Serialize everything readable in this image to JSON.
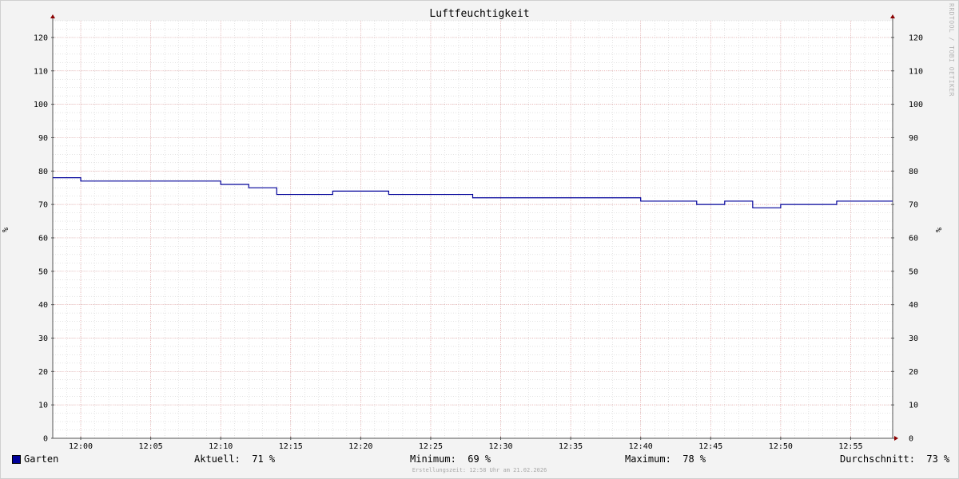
{
  "chart_data": {
    "type": "line",
    "title": "Luftfeuchtigkeit",
    "ylabel": "%",
    "ylabel_right": "%",
    "ylim": [
      0,
      125
    ],
    "yticks": [
      0,
      10,
      20,
      30,
      40,
      50,
      60,
      70,
      80,
      90,
      100,
      110,
      120
    ],
    "xlim": [
      "11:58",
      "12:58"
    ],
    "xticks": [
      "12:00",
      "12:05",
      "12:10",
      "12:15",
      "12:20",
      "12:25",
      "12:30",
      "12:35",
      "12:40",
      "12:45",
      "12:50",
      "12:55"
    ],
    "grid": true,
    "series": [
      {
        "name": "Garten",
        "color": "#000099",
        "step": true,
        "points": [
          [
            "11:58",
            78
          ],
          [
            "12:00",
            77
          ],
          [
            "12:10",
            76
          ],
          [
            "12:12",
            75
          ],
          [
            "12:14",
            73
          ],
          [
            "12:18",
            74
          ],
          [
            "12:22",
            73
          ],
          [
            "12:28",
            72
          ],
          [
            "12:40",
            71
          ],
          [
            "12:44",
            70
          ],
          [
            "12:46",
            71
          ],
          [
            "12:48",
            69
          ],
          [
            "12:50",
            70
          ],
          [
            "12:54",
            71
          ],
          [
            "12:58",
            71
          ]
        ]
      }
    ]
  },
  "legend": {
    "series_name": "Garten",
    "current": "Aktuell:  71 %",
    "minimum": "Minimum:  69 %",
    "maximum": "Maximum:  78 %",
    "average": "Durchschnitt:  73 %"
  },
  "footer": "Erstellungszeit: 12:58 Uhr am 21.02.2026",
  "watermark": "RRDTOOL / TOBI OETIKER",
  "colors": {
    "series": "#000099",
    "major_grid": "#e8a0a0",
    "minor_grid": "#c8c8c8",
    "arrow": "#8b0000"
  }
}
